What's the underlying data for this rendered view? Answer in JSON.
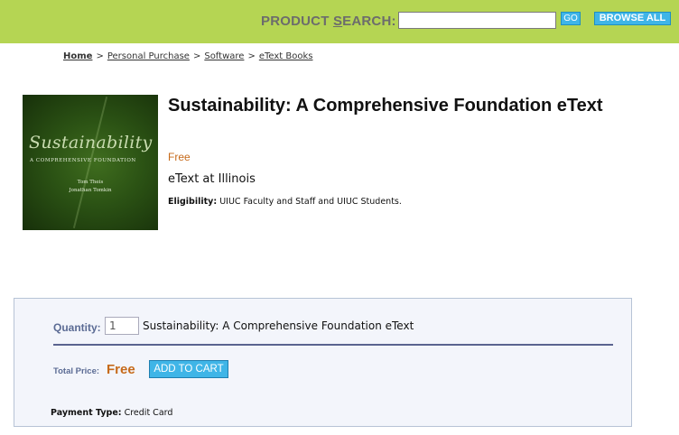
{
  "header": {
    "search_label_before": "PRODUCT ",
    "search_label_underlined": "S",
    "search_label_after": "EARCH:",
    "search_value": "",
    "go_label": "GO",
    "browse_all_label": "BROWSE ALL",
    "bar_color": "#b5d553",
    "button_color": "#3fb5e7"
  },
  "breadcrumb": {
    "items": [
      "Home",
      "Personal Purchase",
      "Software",
      "eText Books"
    ],
    "separator": ">"
  },
  "cover": {
    "title": "Sustainability",
    "subtitle": "A COMPREHENSIVE FOUNDATION",
    "author1": "Tom Theis",
    "author2": "Jonathan Tomkin"
  },
  "product": {
    "title": "Sustainability: A Comprehensive Foundation eText",
    "price": "Free",
    "variant": "eText at Illinois",
    "eligibility_label": "Eligibility:",
    "eligibility_value": "UIUC Faculty and Staff and UIUC Students."
  },
  "cart": {
    "quantity_label": "Quantity:",
    "quantity_value": "1",
    "item_name": "Sustainability: A Comprehensive Foundation eText",
    "total_label": "Total Price:",
    "total_value": "Free",
    "add_to_cart_label": "ADD TO CART",
    "payment_label": "Payment Type:",
    "payment_value": "Credit Card",
    "price_color": "#c66a1a"
  }
}
